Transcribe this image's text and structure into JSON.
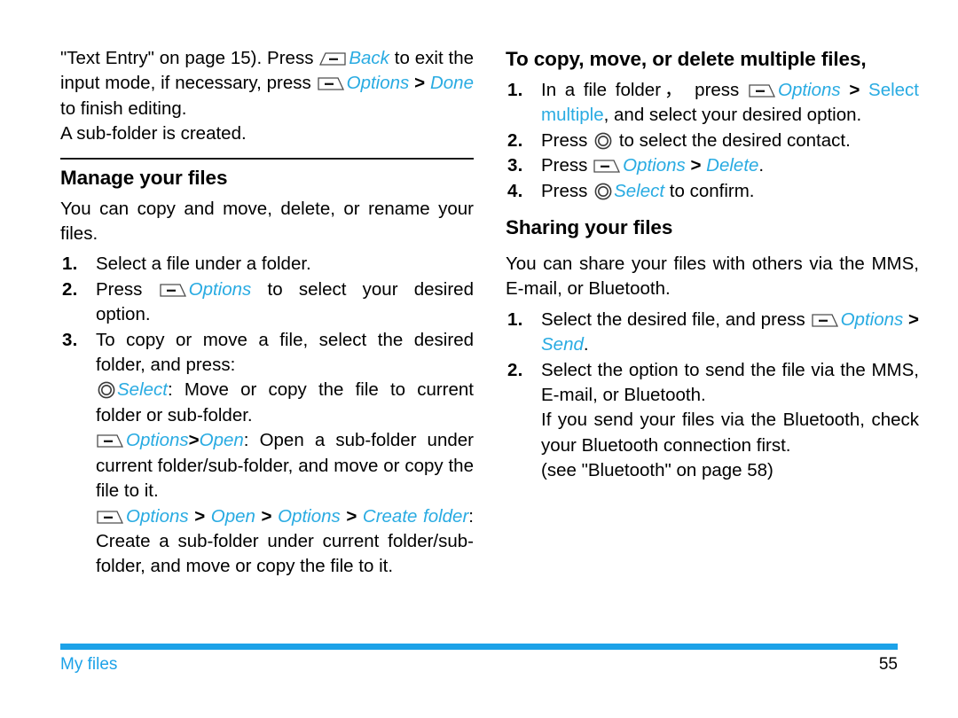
{
  "meta": {
    "accent_blue": "#29ABE2",
    "footer_blue": "#1CA2E8",
    "text_black": "#000000"
  },
  "icons": {
    "softkey_left": "left-softkey-icon",
    "softkey_right": "right-softkey-icon",
    "select_key": "select-key-icon"
  },
  "left_column": {
    "continued_paragraph": {
      "part1": "\"Text Entry\" on page 15). Press",
      "key_back": "Back",
      "part2": "to exit the input mode, if necessary, press",
      "key_options": "Options",
      "sep": ">",
      "key_done": "Done",
      "part3": "to finish editing."
    },
    "note_line": "A sub-folder is created.",
    "heading": "Manage your files",
    "intro": "You can copy and move, delete, or rename your files.",
    "steps": [
      {
        "num": "1.",
        "text": "Select a file under a folder."
      },
      {
        "num": "2.",
        "pre": "Press",
        "key": "Options",
        "post": "to select your desired option."
      },
      {
        "num": "3.",
        "text": "To copy or move a file, select the desired folder, and press:"
      }
    ],
    "sub_items": [
      {
        "key": "Select",
        "text": ":  Move or copy the file to current folder or sub-folder."
      },
      {
        "key1": "Options",
        "sep1": ">",
        "key2": "Open",
        "text": ": Open a sub-folder under current folder/sub-folder, and move or copy the file to it."
      },
      {
        "key1": "Options",
        "sep1": ">",
        "key2": "Open",
        "sep2": ">",
        "key3": "Options",
        "sep3": ">",
        "key4": "Create folder",
        "text": ": Create a sub-folder under current folder/sub-folder, and move or copy the file to it."
      }
    ]
  },
  "right_column": {
    "heading_multiple": "To copy, move, or delete multiple files,",
    "steps_multiple": [
      {
        "num": "1.",
        "pre": "In a file folder，  press",
        "key": "Options",
        "sep": ">",
        "key2": "Select multiple",
        "post": ", and select your desired option."
      },
      {
        "num": "2.",
        "pre": "Press",
        "post": "to select the desired contact."
      },
      {
        "num": "3.",
        "pre": "Press",
        "key": "Options",
        "sep": ">",
        "key2": "Delete",
        "post": "."
      },
      {
        "num": "4.",
        "pre": "Press",
        "key2": "Select",
        "post": "to confirm."
      }
    ],
    "heading_sharing": "Sharing your files",
    "sharing_intro": "You can share your files with others via the MMS, E-mail, or Bluetooth.",
    "steps_sharing": [
      {
        "num": "1.",
        "pre": "Select the desired file, and press",
        "key": "Options",
        "sep": ">",
        "key2": "Send",
        "post": "."
      },
      {
        "num": "2.",
        "text": "Select the option to send the file via the MMS, E-mail, or Bluetooth.",
        "extra1": "If you send your files via the Bluetooth, check your Bluetooth connection first.",
        "extra2": "(see \"Bluetooth\" on page 58)"
      }
    ]
  },
  "footer": {
    "section_label": "My files",
    "page_number": "55"
  }
}
